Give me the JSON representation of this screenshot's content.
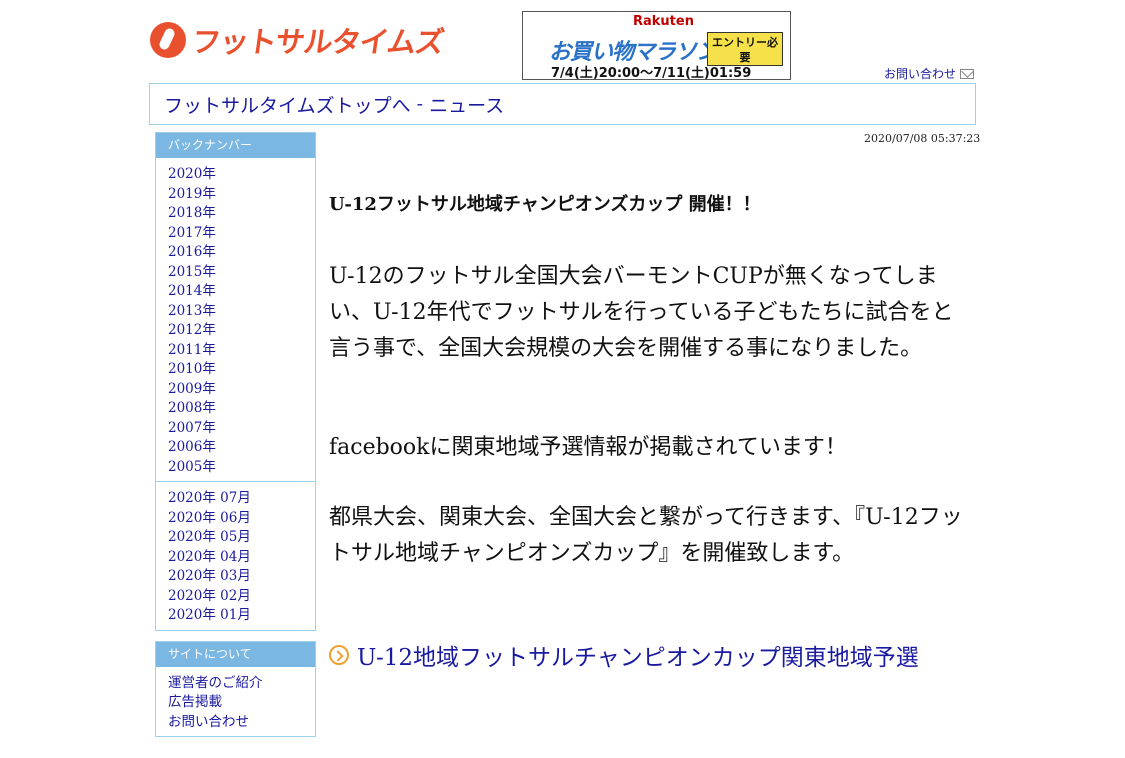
{
  "header": {
    "logo_text": "フットサルタイムズ",
    "contact_link": "お問い合わせ"
  },
  "banner": {
    "brand": "Rakuten",
    "title": "お買い物マラソン",
    "badge": "エントリー必要",
    "date": "7/4(土)20:00〜7/11(土)01:59"
  },
  "breadcrumb": {
    "home": "フットサルタイムズトップへ",
    "separator": " - ",
    "current": "ニュース"
  },
  "sidebar": {
    "backnumber_title": "バックナンバー",
    "years": [
      "2020年",
      "2019年",
      "2018年",
      "2017年",
      "2016年",
      "2015年",
      "2014年",
      "2013年",
      "2012年",
      "2011年",
      "2010年",
      "2009年",
      "2008年",
      "2007年",
      "2006年",
      "2005年"
    ],
    "months": [
      "2020年 07月",
      "2020年 06月",
      "2020年 05月",
      "2020年 04月",
      "2020年 03月",
      "2020年 02月",
      "2020年 01月"
    ],
    "about_title": "サイトについて",
    "about_items": [
      "運営者のご紹介",
      "広告掲載",
      "お問い合わせ"
    ]
  },
  "article": {
    "timestamp": "2020/07/08 05:37:23",
    "headline": "U-12フットサル地域チャンピオンズカップ 開催！！",
    "paragraphs": [
      "U-12のフットサル全国大会バーモントCUPが無くなってしまい、U-12年代でフットサルを行っている子どもたちに試合をと言う事で、全国大会規模の大会を開催する事になりました。",
      "facebookに関東地域予選情報が掲載されています！",
      "都県大会、関東大会、全国大会と繋がって行きます、『U-12フットサル地域チャンピオンズカップ』を開催致します。"
    ],
    "related_link": "U-12地域フットサルチャンピオンカップ関東地域予選"
  },
  "colors": {
    "accent": "#7ab7e2",
    "border": "#9fd2ea",
    "link": "#1a1aa0",
    "logo": "#e8502e"
  }
}
